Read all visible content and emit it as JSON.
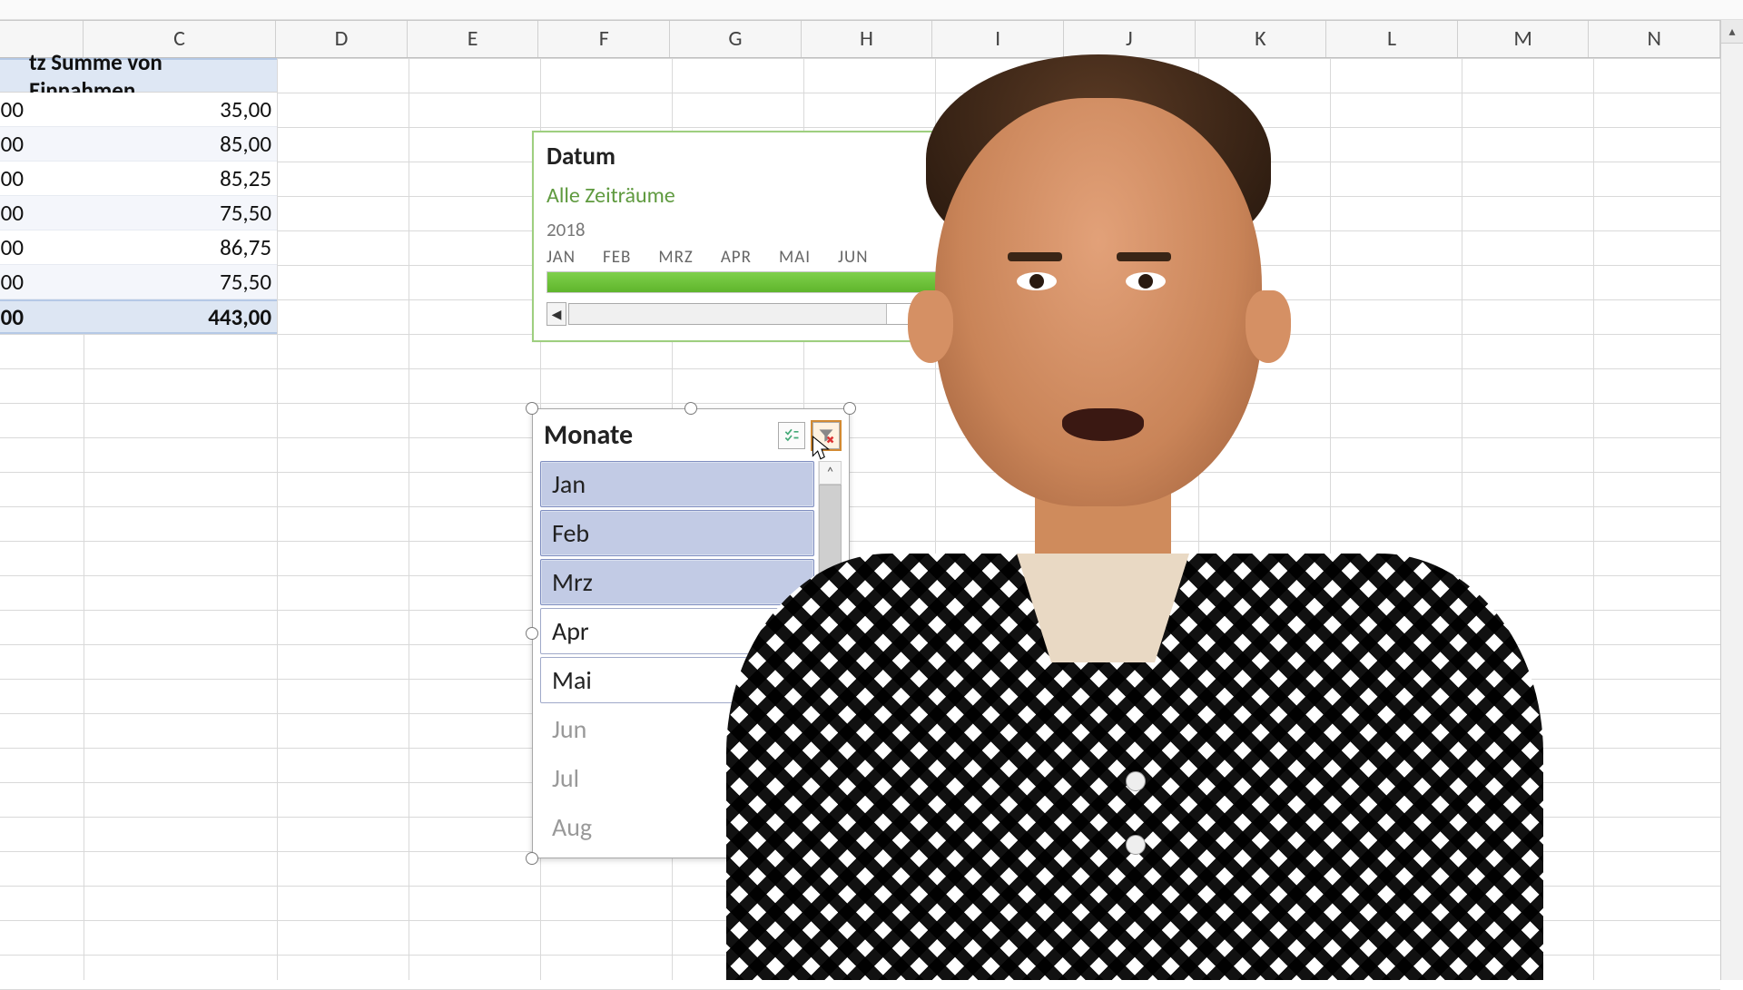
{
  "columns": [
    "C",
    "D",
    "E",
    "F",
    "G",
    "H",
    "I",
    "J",
    "K",
    "L",
    "M",
    "N"
  ],
  "pivot": {
    "header_label": "tz  Summe von Einnahmen",
    "partial_suffix": "00",
    "rows": [
      "35,00",
      "85,00",
      "85,25",
      "75,50",
      "86,75",
      "75,50"
    ],
    "total": "443,00"
  },
  "timeline": {
    "title": "Datum",
    "range_label": "Alle Zeiträume",
    "year": "2018",
    "months": [
      "JAN",
      "FEB",
      "MRZ",
      "APR",
      "MAI",
      "JUN"
    ],
    "scroll_left_glyph": "◀"
  },
  "slicer": {
    "title": "Monate",
    "multi_icon_alt": "multi-select-icon",
    "clear_icon_alt": "clear-filter-icon",
    "scroll_up_glyph": "˄",
    "items": [
      {
        "label": "Jan",
        "state": "sel"
      },
      {
        "label": "Feb",
        "state": "sel"
      },
      {
        "label": "Mrz",
        "state": "sel"
      },
      {
        "label": "Apr",
        "state": "plain"
      },
      {
        "label": "Mai",
        "state": "plain"
      },
      {
        "label": "Jun",
        "state": "dim"
      },
      {
        "label": "Jul",
        "state": "dim"
      },
      {
        "label": "Aug",
        "state": "dim"
      }
    ]
  }
}
